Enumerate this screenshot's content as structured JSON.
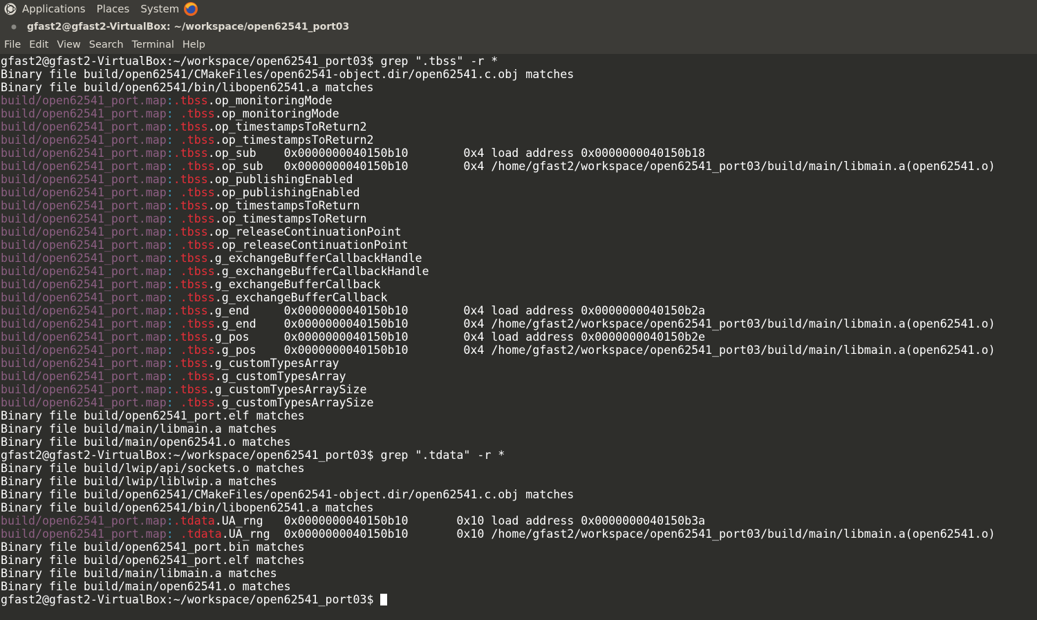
{
  "top_panel": {
    "menus": [
      "Applications",
      "Places",
      "System"
    ]
  },
  "window": {
    "title": "gfast2@gfast2-VirtualBox: ~/workspace/open62541_port03"
  },
  "menubar": {
    "items": [
      "File",
      "Edit",
      "View",
      "Search",
      "Terminal",
      "Help"
    ]
  },
  "colors": {
    "terminal_bg": "#2e2e2b",
    "filename": "#8d5f83",
    "separator": "#3ca5cb",
    "match": "#e62e38",
    "panel_bg": "#3c3b37"
  },
  "terminal": {
    "lines": [
      {
        "segs": [
          {
            "t": "gfast2@gfast2-VirtualBox:~/workspace/open62541_port03$ grep \".tbss\" -r *"
          }
        ]
      },
      {
        "segs": [
          {
            "t": "Binary file build/open62541/CMakeFiles/open62541-object.dir/open62541.c.obj matches"
          }
        ]
      },
      {
        "segs": [
          {
            "t": "Binary file build/open62541/bin/libopen62541.a matches"
          }
        ]
      },
      {
        "segs": [
          {
            "t": "build/open62541_port.map",
            "c": "fn"
          },
          {
            "t": ":",
            "c": "sep"
          },
          {
            "t": ".tbss",
            "c": "hl"
          },
          {
            "t": ".op_monitoringMode"
          }
        ]
      },
      {
        "segs": [
          {
            "t": "build/open62541_port.map",
            "c": "fn"
          },
          {
            "t": ":",
            "c": "sep"
          },
          {
            "t": " "
          },
          {
            "t": ".tbss",
            "c": "hl"
          },
          {
            "t": ".op_monitoringMode"
          }
        ]
      },
      {
        "segs": [
          {
            "t": "build/open62541_port.map",
            "c": "fn"
          },
          {
            "t": ":",
            "c": "sep"
          },
          {
            "t": ".tbss",
            "c": "hl"
          },
          {
            "t": ".op_timestampsToReturn2"
          }
        ]
      },
      {
        "segs": [
          {
            "t": "build/open62541_port.map",
            "c": "fn"
          },
          {
            "t": ":",
            "c": "sep"
          },
          {
            "t": " "
          },
          {
            "t": ".tbss",
            "c": "hl"
          },
          {
            "t": ".op_timestampsToReturn2"
          }
        ]
      },
      {
        "segs": [
          {
            "t": "build/open62541_port.map",
            "c": "fn"
          },
          {
            "t": ":",
            "c": "sep"
          },
          {
            "t": ".tbss",
            "c": "hl"
          },
          {
            "t": ".op_sub    0x0000000040150b10        0x4 load address 0x0000000040150b18"
          }
        ]
      },
      {
        "segs": [
          {
            "t": "build/open62541_port.map",
            "c": "fn"
          },
          {
            "t": ":",
            "c": "sep"
          },
          {
            "t": " "
          },
          {
            "t": ".tbss",
            "c": "hl"
          },
          {
            "t": ".op_sub   0x0000000040150b10        0x4 /home/gfast2/workspace/open62541_port03/build/main/libmain.a(open62541.o)"
          }
        ]
      },
      {
        "segs": [
          {
            "t": "build/open62541_port.map",
            "c": "fn"
          },
          {
            "t": ":",
            "c": "sep"
          },
          {
            "t": ".tbss",
            "c": "hl"
          },
          {
            "t": ".op_publishingEnabled"
          }
        ]
      },
      {
        "segs": [
          {
            "t": "build/open62541_port.map",
            "c": "fn"
          },
          {
            "t": ":",
            "c": "sep"
          },
          {
            "t": " "
          },
          {
            "t": ".tbss",
            "c": "hl"
          },
          {
            "t": ".op_publishingEnabled"
          }
        ]
      },
      {
        "segs": [
          {
            "t": "build/open62541_port.map",
            "c": "fn"
          },
          {
            "t": ":",
            "c": "sep"
          },
          {
            "t": ".tbss",
            "c": "hl"
          },
          {
            "t": ".op_timestampsToReturn"
          }
        ]
      },
      {
        "segs": [
          {
            "t": "build/open62541_port.map",
            "c": "fn"
          },
          {
            "t": ":",
            "c": "sep"
          },
          {
            "t": " "
          },
          {
            "t": ".tbss",
            "c": "hl"
          },
          {
            "t": ".op_timestampsToReturn"
          }
        ]
      },
      {
        "segs": [
          {
            "t": "build/open62541_port.map",
            "c": "fn"
          },
          {
            "t": ":",
            "c": "sep"
          },
          {
            "t": ".tbss",
            "c": "hl"
          },
          {
            "t": ".op_releaseContinuationPoint"
          }
        ]
      },
      {
        "segs": [
          {
            "t": "build/open62541_port.map",
            "c": "fn"
          },
          {
            "t": ":",
            "c": "sep"
          },
          {
            "t": " "
          },
          {
            "t": ".tbss",
            "c": "hl"
          },
          {
            "t": ".op_releaseContinuationPoint"
          }
        ]
      },
      {
        "segs": [
          {
            "t": "build/open62541_port.map",
            "c": "fn"
          },
          {
            "t": ":",
            "c": "sep"
          },
          {
            "t": ".tbss",
            "c": "hl"
          },
          {
            "t": ".g_exchangeBufferCallbackHandle"
          }
        ]
      },
      {
        "segs": [
          {
            "t": "build/open62541_port.map",
            "c": "fn"
          },
          {
            "t": ":",
            "c": "sep"
          },
          {
            "t": " "
          },
          {
            "t": ".tbss",
            "c": "hl"
          },
          {
            "t": ".g_exchangeBufferCallbackHandle"
          }
        ]
      },
      {
        "segs": [
          {
            "t": "build/open62541_port.map",
            "c": "fn"
          },
          {
            "t": ":",
            "c": "sep"
          },
          {
            "t": ".tbss",
            "c": "hl"
          },
          {
            "t": ".g_exchangeBufferCallback"
          }
        ]
      },
      {
        "segs": [
          {
            "t": "build/open62541_port.map",
            "c": "fn"
          },
          {
            "t": ":",
            "c": "sep"
          },
          {
            "t": " "
          },
          {
            "t": ".tbss",
            "c": "hl"
          },
          {
            "t": ".g_exchangeBufferCallback"
          }
        ]
      },
      {
        "segs": [
          {
            "t": "build/open62541_port.map",
            "c": "fn"
          },
          {
            "t": ":",
            "c": "sep"
          },
          {
            "t": ".tbss",
            "c": "hl"
          },
          {
            "t": ".g_end     0x0000000040150b10        0x4 load address 0x0000000040150b2a"
          }
        ]
      },
      {
        "segs": [
          {
            "t": "build/open62541_port.map",
            "c": "fn"
          },
          {
            "t": ":",
            "c": "sep"
          },
          {
            "t": " "
          },
          {
            "t": ".tbss",
            "c": "hl"
          },
          {
            "t": ".g_end    0x0000000040150b10        0x4 /home/gfast2/workspace/open62541_port03/build/main/libmain.a(open62541.o)"
          }
        ]
      },
      {
        "segs": [
          {
            "t": "build/open62541_port.map",
            "c": "fn"
          },
          {
            "t": ":",
            "c": "sep"
          },
          {
            "t": ".tbss",
            "c": "hl"
          },
          {
            "t": ".g_pos     0x0000000040150b10        0x4 load address 0x0000000040150b2e"
          }
        ]
      },
      {
        "segs": [
          {
            "t": "build/open62541_port.map",
            "c": "fn"
          },
          {
            "t": ":",
            "c": "sep"
          },
          {
            "t": " "
          },
          {
            "t": ".tbss",
            "c": "hl"
          },
          {
            "t": ".g_pos    0x0000000040150b10        0x4 /home/gfast2/workspace/open62541_port03/build/main/libmain.a(open62541.o)"
          }
        ]
      },
      {
        "segs": [
          {
            "t": "build/open62541_port.map",
            "c": "fn"
          },
          {
            "t": ":",
            "c": "sep"
          },
          {
            "t": ".tbss",
            "c": "hl"
          },
          {
            "t": ".g_customTypesArray"
          }
        ]
      },
      {
        "segs": [
          {
            "t": "build/open62541_port.map",
            "c": "fn"
          },
          {
            "t": ":",
            "c": "sep"
          },
          {
            "t": " "
          },
          {
            "t": ".tbss",
            "c": "hl"
          },
          {
            "t": ".g_customTypesArray"
          }
        ]
      },
      {
        "segs": [
          {
            "t": "build/open62541_port.map",
            "c": "fn"
          },
          {
            "t": ":",
            "c": "sep"
          },
          {
            "t": ".tbss",
            "c": "hl"
          },
          {
            "t": ".g_customTypesArraySize"
          }
        ]
      },
      {
        "segs": [
          {
            "t": "build/open62541_port.map",
            "c": "fn"
          },
          {
            "t": ":",
            "c": "sep"
          },
          {
            "t": " "
          },
          {
            "t": ".tbss",
            "c": "hl"
          },
          {
            "t": ".g_customTypesArraySize"
          }
        ]
      },
      {
        "segs": [
          {
            "t": "Binary file build/open62541_port.elf matches"
          }
        ]
      },
      {
        "segs": [
          {
            "t": "Binary file build/main/libmain.a matches"
          }
        ]
      },
      {
        "segs": [
          {
            "t": "Binary file build/main/open62541.o matches"
          }
        ]
      },
      {
        "segs": [
          {
            "t": "gfast2@gfast2-VirtualBox:~/workspace/open62541_port03$ grep \".tdata\" -r *"
          }
        ]
      },
      {
        "segs": [
          {
            "t": "Binary file build/lwip/api/sockets.o matches"
          }
        ]
      },
      {
        "segs": [
          {
            "t": "Binary file build/lwip/liblwip.a matches"
          }
        ]
      },
      {
        "segs": [
          {
            "t": "Binary file build/open62541/CMakeFiles/open62541-object.dir/open62541.c.obj matches"
          }
        ]
      },
      {
        "segs": [
          {
            "t": "Binary file build/open62541/bin/libopen62541.a matches"
          }
        ]
      },
      {
        "segs": [
          {
            "t": "build/open62541_port.map",
            "c": "fn"
          },
          {
            "t": ":",
            "c": "sep"
          },
          {
            "t": ".tdata",
            "c": "hl"
          },
          {
            "t": ".UA_rng   0x0000000040150b10       0x10 load address 0x0000000040150b3a"
          }
        ]
      },
      {
        "segs": [
          {
            "t": "build/open62541_port.map",
            "c": "fn"
          },
          {
            "t": ":",
            "c": "sep"
          },
          {
            "t": " "
          },
          {
            "t": ".tdata",
            "c": "hl"
          },
          {
            "t": ".UA_rng  0x0000000040150b10       0x10 /home/gfast2/workspace/open62541_port03/build/main/libmain.a(open62541.o)"
          }
        ]
      },
      {
        "segs": [
          {
            "t": "Binary file build/open62541_port.bin matches"
          }
        ]
      },
      {
        "segs": [
          {
            "t": "Binary file build/open62541_port.elf matches"
          }
        ]
      },
      {
        "segs": [
          {
            "t": "Binary file build/main/libmain.a matches"
          }
        ]
      },
      {
        "segs": [
          {
            "t": "Binary file build/main/open62541.o matches"
          }
        ]
      },
      {
        "segs": [
          {
            "t": "gfast2@gfast2-VirtualBox:~/workspace/open62541_port03$ "
          }
        ],
        "cursor": true
      }
    ]
  }
}
